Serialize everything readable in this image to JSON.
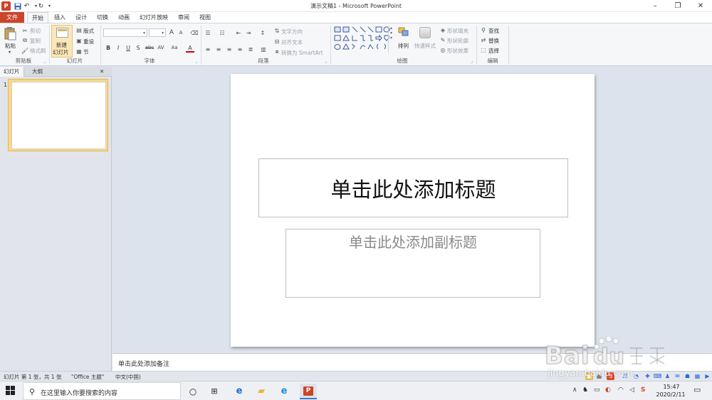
{
  "window": {
    "title": "演示文稿1 - Microsoft PowerPoint",
    "app_icon": "P",
    "minimize": "–",
    "restore": "❐",
    "close": "✕"
  },
  "quick_access": [
    "save-icon",
    "undo-icon",
    "redo-icon",
    "customize-icon"
  ],
  "tabs": [
    "文件",
    "开始",
    "插入",
    "设计",
    "切换",
    "动画",
    "幻灯片放映",
    "审阅",
    "视图"
  ],
  "ribbon": {
    "clipboard": {
      "paste": "粘贴",
      "cut": "剪切",
      "copy": "复制",
      "format_painter": "格式刷",
      "label": "剪贴板"
    },
    "slides": {
      "new_slide_1": "新建",
      "new_slide_2": "幻灯片",
      "layout": "版式",
      "reset": "重设",
      "section": "节",
      "label": "幻灯片"
    },
    "font": {
      "label": "字体",
      "bold": "B",
      "italic": "I",
      "underline": "U",
      "shadow": "S",
      "strike": "abc",
      "spacing": "AV",
      "case": "Aa",
      "color": "A",
      "grow": "A",
      "shrink": "A"
    },
    "paragraph": {
      "text_direction": "文字方向",
      "align_text": "对齐文本",
      "smartart": "转换为 SmartArt",
      "label": "段落"
    },
    "drawing": {
      "arrange": "排列",
      "quick_styles": "快速样式",
      "shape_fill": "形状填充",
      "shape_outline": "形状轮廓",
      "shape_effects": "形状效果",
      "label": "绘图"
    },
    "editing": {
      "find": "查找",
      "replace": "替换",
      "select": "选择",
      "label": "编辑"
    }
  },
  "left_panel": {
    "tabs": [
      "幻灯片",
      "大纲"
    ],
    "close": "✕",
    "slide_number": "1"
  },
  "slide": {
    "title_placeholder": "单击此处添加标题",
    "subtitle_placeholder": "单击此处添加副标题"
  },
  "notes": {
    "placeholder": "单击此处添加备注"
  },
  "status": {
    "slide_info": "幻灯片 第 1 张，共 1 张",
    "theme": "\"Office 主题\"",
    "language": "中文(中国)"
  },
  "taskbar": {
    "search_placeholder": "在这里输入你要搜索的内容",
    "time": "15:47",
    "date": "2020/2/11"
  },
  "watermark": {
    "url": "jingyan.baidu.com"
  },
  "colors": {
    "accent": "#c9452b",
    "thumb_highlight": "#f7d98a",
    "ribbon_bg": "#f6f7f9"
  }
}
